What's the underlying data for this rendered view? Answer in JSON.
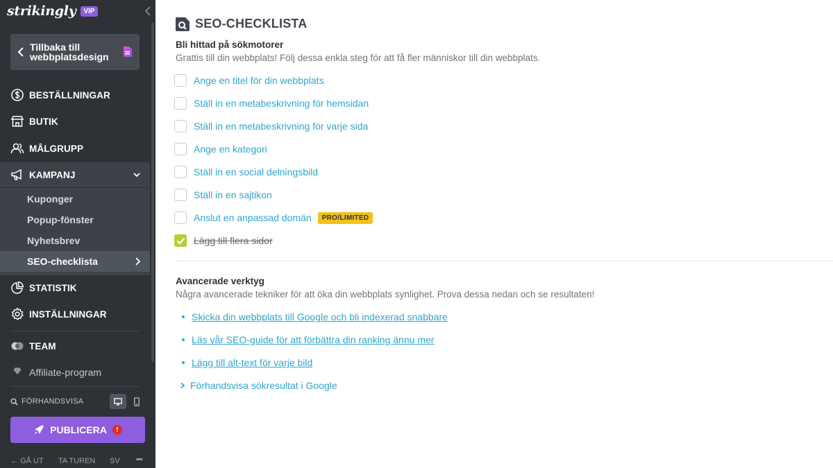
{
  "sidebar": {
    "logo": "strikingly",
    "vip_badge": "VIP",
    "back_button": "Tillbaka till webbplatsdesign",
    "nav": {
      "orders": "BESTÄLLNINGAR",
      "store": "BUTIK",
      "audience": "MÅLGRUPP",
      "campaign": "KAMPANJ",
      "statistics": "STATISTIK",
      "settings": "INSTÄLLNINGAR",
      "team": "TEAM",
      "affiliate": "Affiliate-program"
    },
    "campaign_sub": {
      "coupons": "Kuponger",
      "popup": "Popup-fönster",
      "newsletter": "Nyhetsbrev",
      "seo": "SEO-checklista"
    },
    "preview_label": "FÖRHANDSVISA",
    "publish_label": "PUBLICERA",
    "publish_alert": "!",
    "footer": {
      "exit": "GÅ UT",
      "tour": "TA TUREN",
      "lang": "SV",
      "more": "•••"
    }
  },
  "main": {
    "title": "SEO-CHECKLISTA",
    "found_heading": "Bli hittad på sökmotorer",
    "found_desc": "Grattis till din webbplats! Följ dessa enkla steg för att få fler människor till din webbplats.",
    "checklist": [
      {
        "label": "Ange en titel för din webbplats",
        "checked": false
      },
      {
        "label": "Ställ in en metabeskrivning för hemsidan",
        "checked": false
      },
      {
        "label": "Ställ in en metabeskrivning för varje sida",
        "checked": false
      },
      {
        "label": "Ange en kategori",
        "checked": false
      },
      {
        "label": "Ställ in en social delningsbild",
        "checked": false
      },
      {
        "label": "Ställ in en sajtikon",
        "checked": false
      },
      {
        "label": "Anslut en anpassad domän",
        "checked": false,
        "badge": "PRO/LIMITED"
      },
      {
        "label": "Lägg till flera sidor",
        "checked": true
      }
    ],
    "advanced_heading": "Avancerade verktyg",
    "advanced_desc": "Några avancerade tekniker för att öka din webbplats synlighet. Prova dessa nedan och se resultaten!",
    "advanced_links": [
      "Skicka din webbplats till Google och bli indexerad snabbare",
      "Läs vår SEO-guide för att förbättra din ranking ännu mer",
      "Lägg till alt-text för varje bild"
    ],
    "preview_google": "Förhandsvisa sökresultat i Google"
  },
  "colors": {
    "sidebar_bg": "#2e3237",
    "accent_purple": "#8d5ee0",
    "link_blue": "#2fa6cf",
    "check_green": "#b8cd33",
    "badge_yellow": "#f1c21b"
  }
}
